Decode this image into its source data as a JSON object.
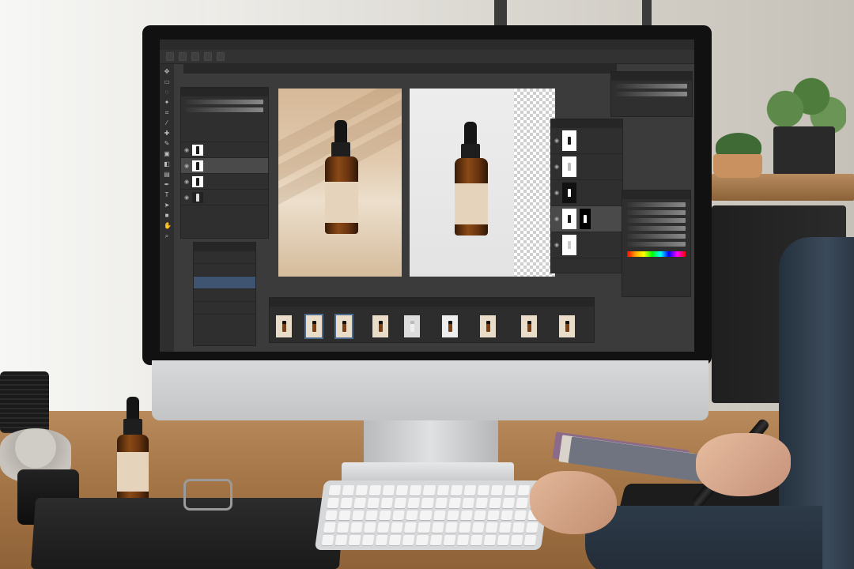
{
  "app": {
    "menu_items": [
      "",
      "",
      "",
      "",
      "",
      "",
      "",
      "",
      ""
    ],
    "doc_tabs": [
      "",
      "",
      ""
    ]
  },
  "layers_panel": {
    "title": "",
    "rows": [
      "",
      "",
      "",
      ""
    ]
  },
  "channels_panel": {
    "title": "",
    "rows": [
      "",
      "",
      "",
      "",
      ""
    ]
  },
  "adjust_panel": {
    "title": ""
  },
  "filmstrip": {
    "title": "",
    "frame_count": 9,
    "selected_frames": [
      1,
      2
    ]
  },
  "colors": {
    "ui_dark": "#3b3b3b",
    "amber_glass": "#8a4a16",
    "label": "#e5d3bb",
    "selection": "#4c6a8e"
  }
}
